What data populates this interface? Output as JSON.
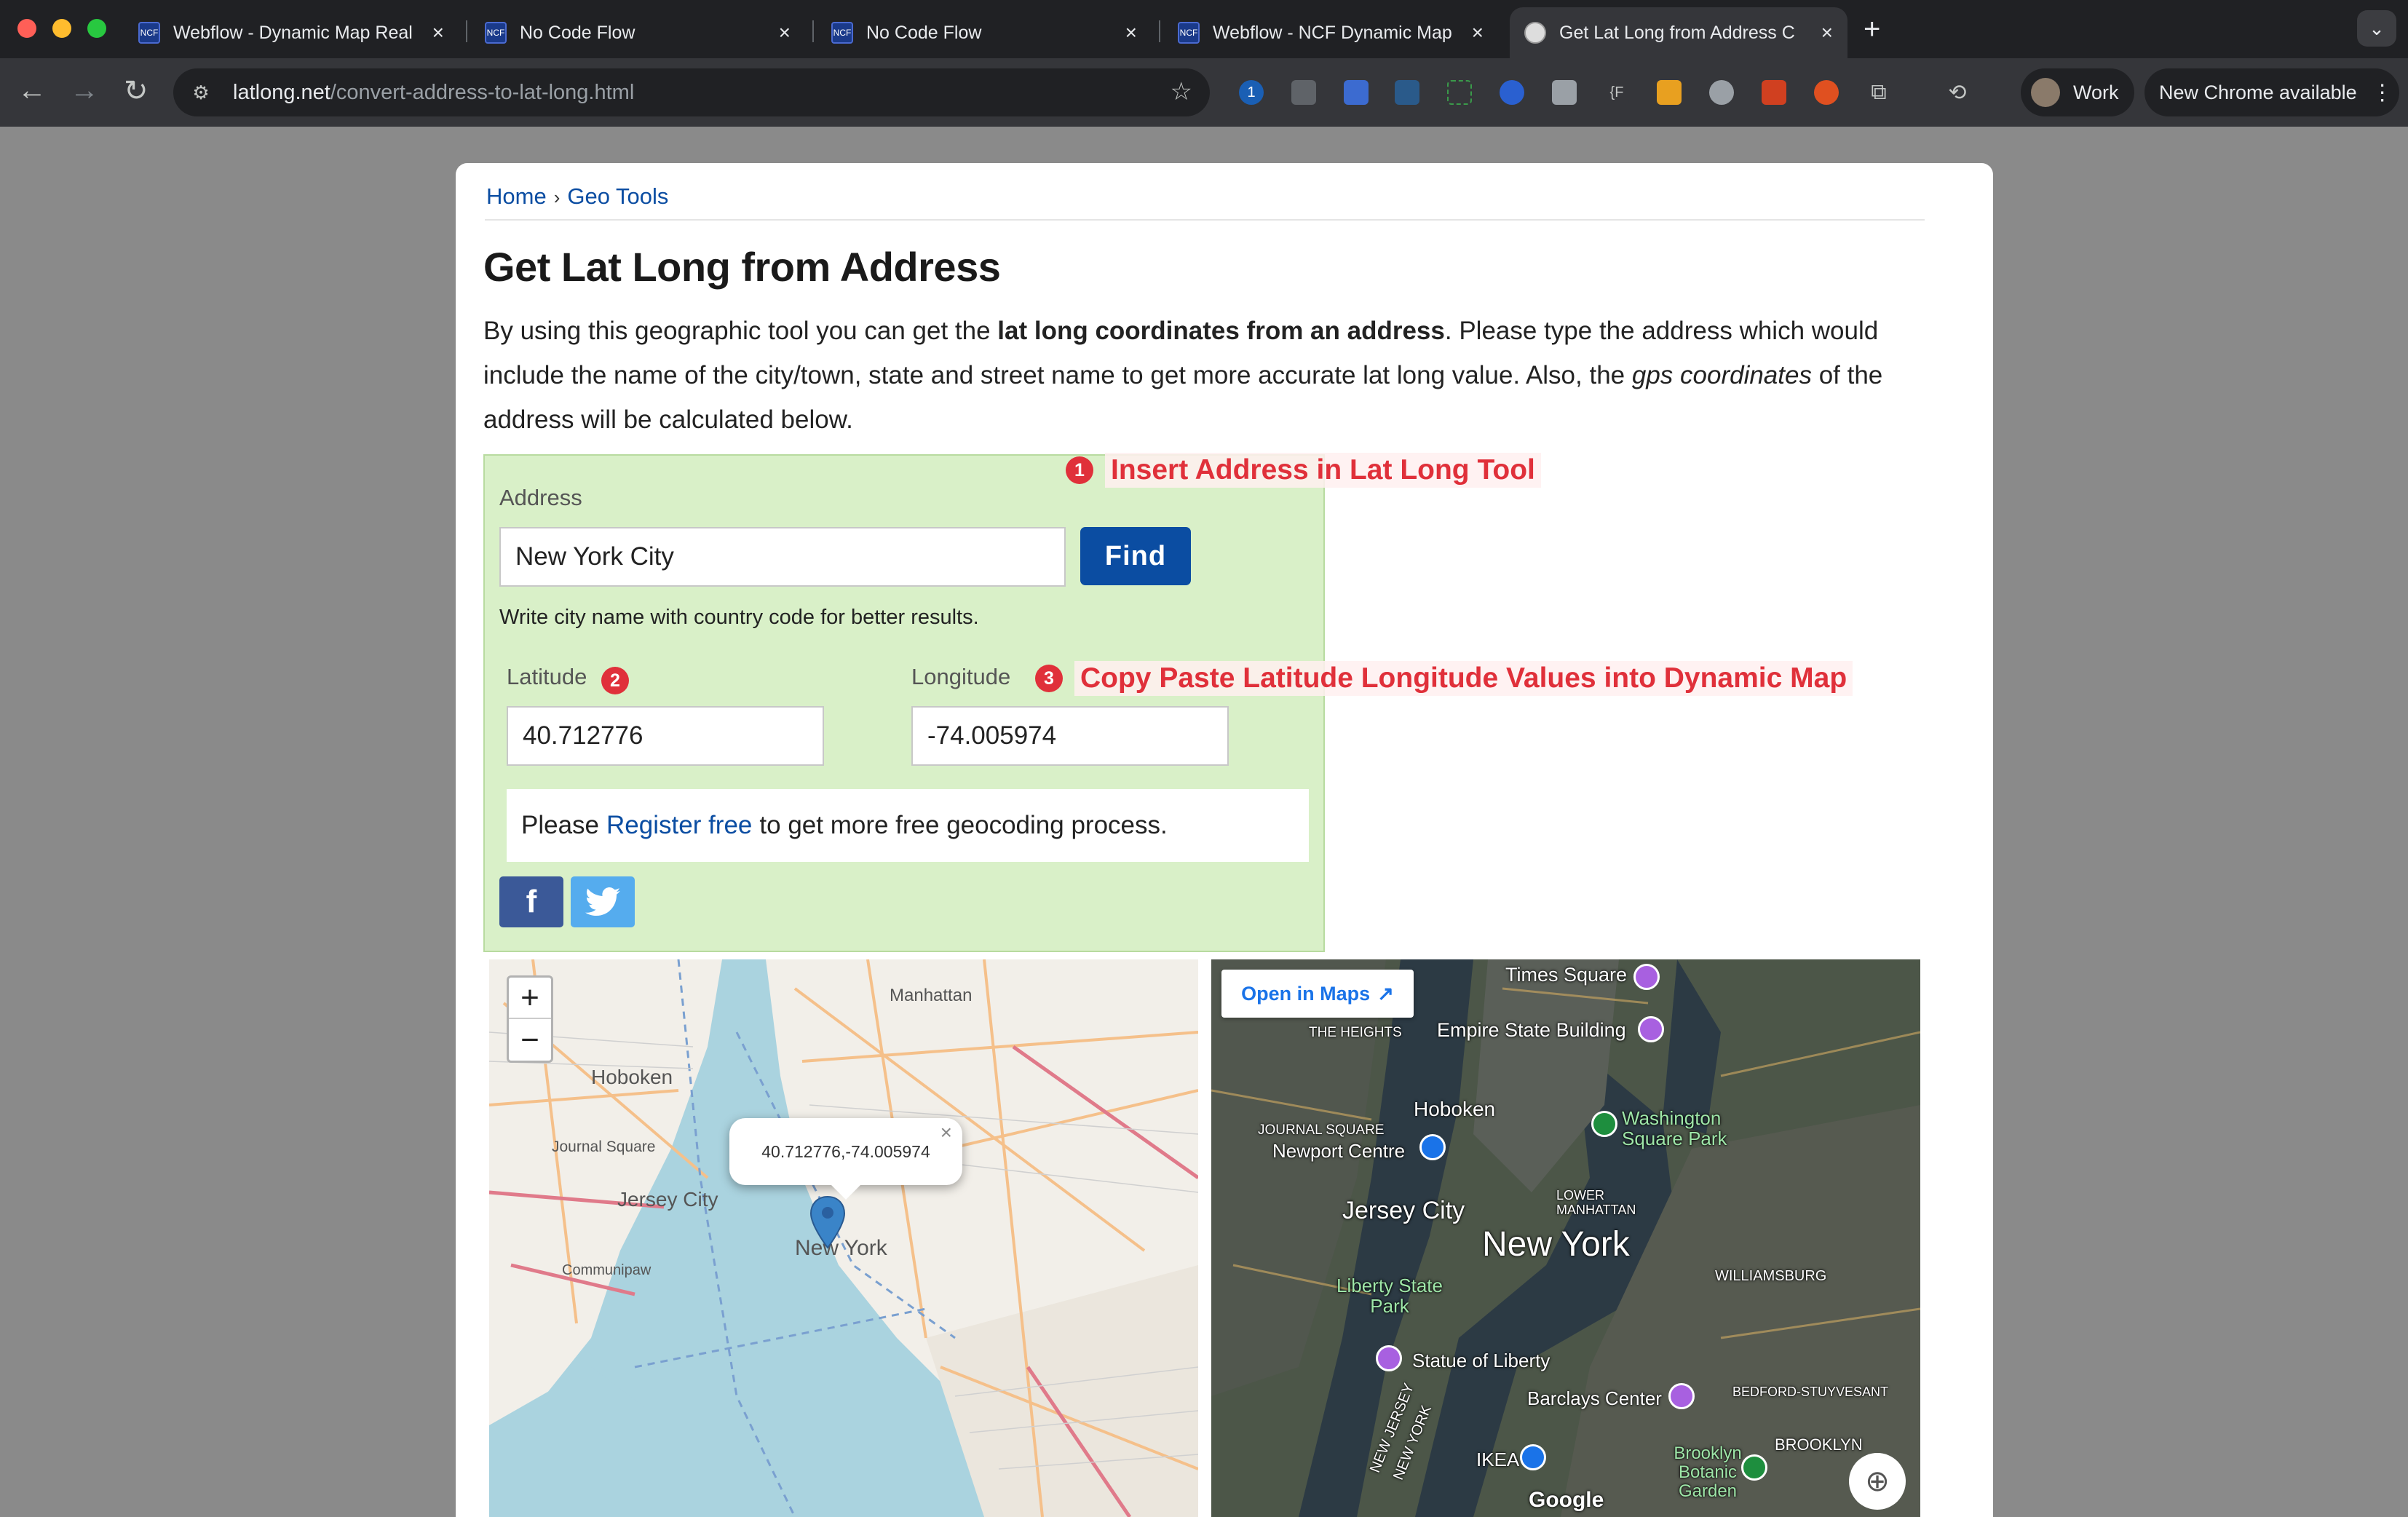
{
  "tabs": [
    {
      "title": "Webflow - Dynamic Map Real",
      "close": "×"
    },
    {
      "title": "No Code Flow",
      "close": "×"
    },
    {
      "title": "No Code Flow",
      "close": "×"
    },
    {
      "title": "Webflow - NCF Dynamic Map",
      "close": "×"
    },
    {
      "title": "Get Lat Long from Address C",
      "close": "×"
    }
  ],
  "tab_fav_text": "NCF",
  "newtab": "+",
  "tabmenu": "⌄",
  "toolbar": {
    "back": "←",
    "forward": "→",
    "reload": "↻",
    "url_host": "latlong.net",
    "url_path": "/convert-address-to-lat-long.html",
    "bookmark": "☆",
    "profile": "Work",
    "update": "New Chrome available",
    "menu": "⋮"
  },
  "breadcrumb": {
    "home": "Home",
    "sep": "›",
    "geo": "Geo Tools"
  },
  "page": {
    "title": "Get Lat Long from Address",
    "intro_1": "By using this geographic tool you can get the ",
    "intro_bold": "lat long coordinates from an address",
    "intro_2": ". Please type the address which would include the name of the city/town, state and street name to get more accurate lat long value. Also, the ",
    "intro_italic": "gps coordinates",
    "intro_3": " of the address will be calculated below."
  },
  "tool": {
    "address_label": "Address",
    "address_value": "New York City",
    "find_button": "Find",
    "hint": "Write city name with country code for better results.",
    "lat_label": "Latitude",
    "lat_value": "40.712776",
    "lng_label": "Longitude",
    "lng_value": "-74.005974",
    "register_pre": "Please",
    "register_link": "Register free",
    "register_post": "to get more free geocoding process.",
    "facebook": "f",
    "twitter": "t"
  },
  "annotations": [
    {
      "num": "1",
      "text": "Insert Address in Lat Long Tool"
    },
    {
      "num": "2",
      "text": ""
    },
    {
      "num": "3",
      "text": "Copy Paste Latitude Longitude Values into Dynamic Map"
    }
  ],
  "map_osm": {
    "zoom_in": "+",
    "zoom_out": "−",
    "popup": "40.712776,-74.005974",
    "popup_close": "×",
    "labels": [
      "Manhattan",
      "Hoboken",
      "Journal Square",
      "Jersey City",
      "New York",
      "Communipaw"
    ]
  },
  "map_google": {
    "open_in_maps": "Open in Maps",
    "open_icon": "↗",
    "labels": [
      "Times Square",
      "Empire State Building",
      "THE HEIGHTS",
      "Hoboken",
      "JOURNAL SQUARE",
      "Newport Centre",
      "Washington Square Park",
      "Jersey City",
      "LOWER MANHATTAN",
      "New York",
      "WILLIAMSBURG",
      "Liberty State Park",
      "Statue of Liberty",
      "Barclays Center",
      "BEDFORD-STUYVESANT",
      "BROOKLYN",
      "IKEA",
      "Brooklyn Botanic Garden",
      "Google",
      "NEW JERSEY",
      "NEW YORK"
    ],
    "locate": "⊕"
  },
  "colors": {
    "link": "#0b4da2",
    "accent_red": "#e0303a",
    "tool_bg": "#d9f0c8",
    "facebook": "#3b5998",
    "twitter": "#55acee"
  }
}
